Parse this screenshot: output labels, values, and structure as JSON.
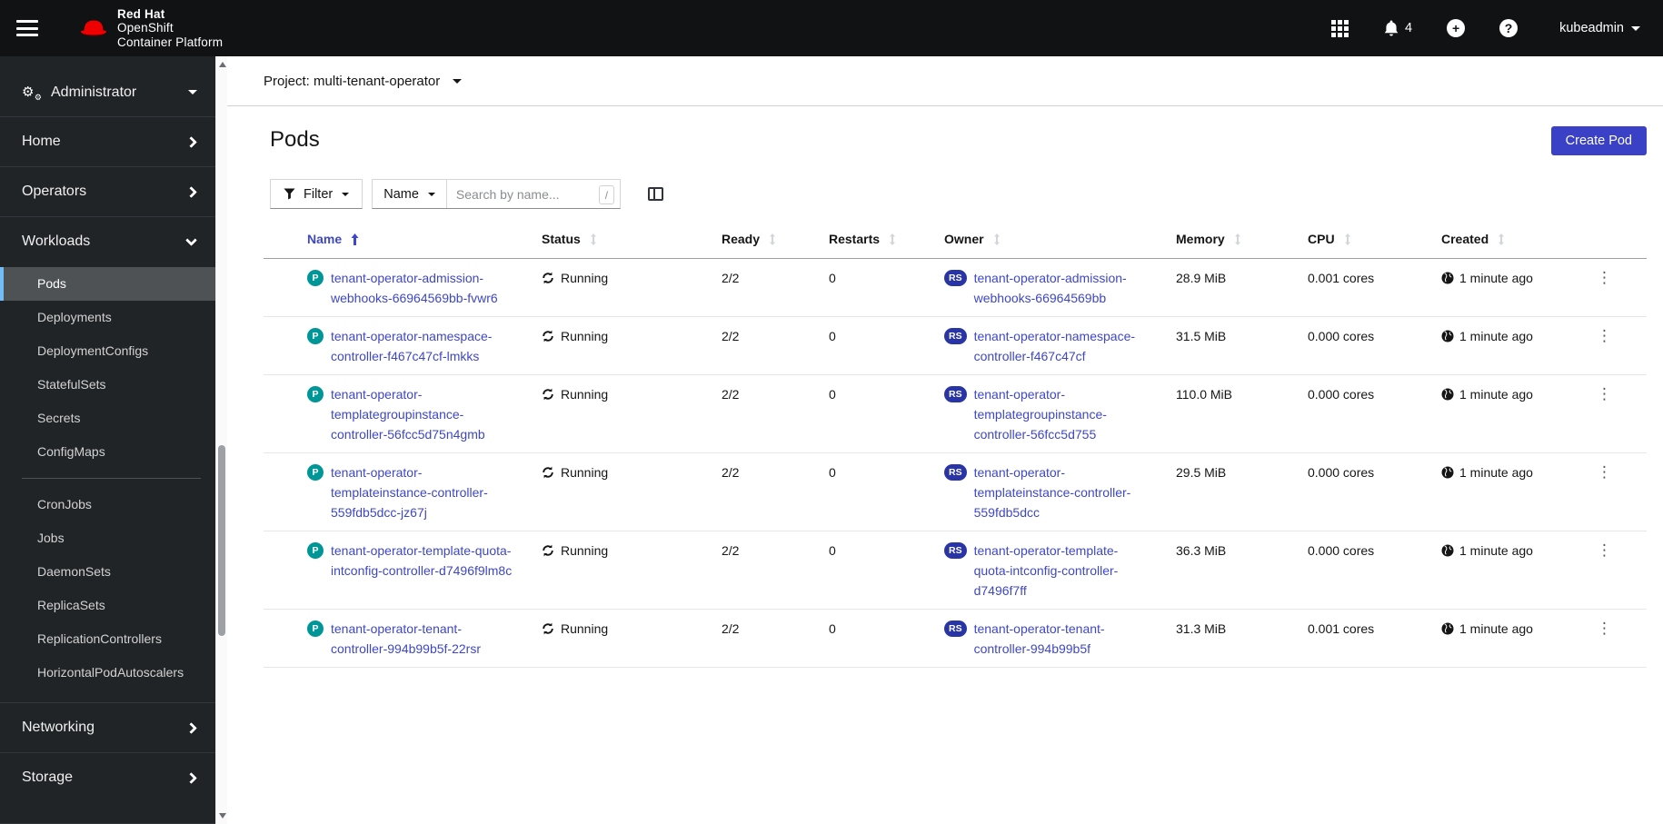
{
  "masthead": {
    "brand": {
      "line1": "Red Hat",
      "line2": "OpenShift",
      "line3": "Container Platform"
    },
    "notification_count": "4",
    "user": "kubeadmin"
  },
  "sidebar": {
    "perspective": "Administrator",
    "groups": [
      {
        "label": "Home",
        "chevron": "right"
      },
      {
        "label": "Operators",
        "chevron": "right"
      },
      {
        "label": "Workloads",
        "chevron": "down",
        "items": [
          {
            "label": "Pods",
            "selected": true
          },
          {
            "label": "Deployments"
          },
          {
            "label": "DeploymentConfigs"
          },
          {
            "label": "StatefulSets"
          },
          {
            "label": "Secrets"
          },
          {
            "label": "ConfigMaps"
          },
          {
            "divider": true
          },
          {
            "label": "CronJobs"
          },
          {
            "label": "Jobs"
          },
          {
            "label": "DaemonSets"
          },
          {
            "label": "ReplicaSets"
          },
          {
            "label": "ReplicationControllers"
          },
          {
            "label": "HorizontalPodAutoscalers"
          }
        ]
      },
      {
        "label": "Networking",
        "chevron": "right"
      },
      {
        "label": "Storage",
        "chevron": "right"
      }
    ]
  },
  "page": {
    "project_label": "Project:",
    "project_name": "multi-tenant-operator",
    "title": "Pods",
    "create_button": "Create Pod"
  },
  "toolbar": {
    "filter_label": "Filter",
    "attribute_label": "Name",
    "search_placeholder": "Search by name...",
    "shortcut_key": "/"
  },
  "table": {
    "columns": [
      "Name",
      "Status",
      "Ready",
      "Restarts",
      "Owner",
      "Memory",
      "CPU",
      "Created"
    ],
    "sorted_column": "Name",
    "sort_direction": "asc",
    "pod_badge": "P",
    "owner_badge": "RS",
    "rows": [
      {
        "name": "tenant-operator-admission-webhooks-66964569bb-fvwr6",
        "status": "Running",
        "ready": "2/2",
        "restarts": "0",
        "owner": "tenant-operator-admission-webhooks-66964569bb",
        "memory": "28.9 MiB",
        "cpu": "0.001 cores",
        "created": "1 minute ago"
      },
      {
        "name": "tenant-operator-namespace-controller-f467c47cf-lmkks",
        "status": "Running",
        "ready": "2/2",
        "restarts": "0",
        "owner": "tenant-operator-namespace-controller-f467c47cf",
        "memory": "31.5 MiB",
        "cpu": "0.000 cores",
        "created": "1 minute ago"
      },
      {
        "name": "tenant-operator-templategroupinstance-controller-56fcc5d75n4gmb",
        "status": "Running",
        "ready": "2/2",
        "restarts": "0",
        "owner": "tenant-operator-templategroupinstance-controller-56fcc5d755",
        "memory": "110.0 MiB",
        "cpu": "0.000 cores",
        "created": "1 minute ago"
      },
      {
        "name": "tenant-operator-templateinstance-controller-559fdb5dcc-jz67j",
        "status": "Running",
        "ready": "2/2",
        "restarts": "0",
        "owner": "tenant-operator-templateinstance-controller-559fdb5dcc",
        "memory": "29.5 MiB",
        "cpu": "0.000 cores",
        "created": "1 minute ago"
      },
      {
        "name": "tenant-operator-template-quota-intconfig-controller-d7496f9lm8c",
        "status": "Running",
        "ready": "2/2",
        "restarts": "0",
        "owner": "tenant-operator-template-quota-intconfig-controller-d7496f7ff",
        "memory": "36.3 MiB",
        "cpu": "0.000 cores",
        "created": "1 minute ago"
      },
      {
        "name": "tenant-operator-tenant-controller-994b99b5f-22rsr",
        "status": "Running",
        "ready": "2/2",
        "restarts": "0",
        "owner": "tenant-operator-tenant-controller-994b99b5f",
        "memory": "31.3 MiB",
        "cpu": "0.001 cores",
        "created": "1 minute ago"
      }
    ]
  },
  "colors": {
    "primary": "#3a41c6",
    "link": "#3e47c7",
    "pod_badge": "#009596",
    "rs_badge": "#2a35a5",
    "nav_accent": "#73bcf7",
    "brand_red": "#ee0000"
  }
}
